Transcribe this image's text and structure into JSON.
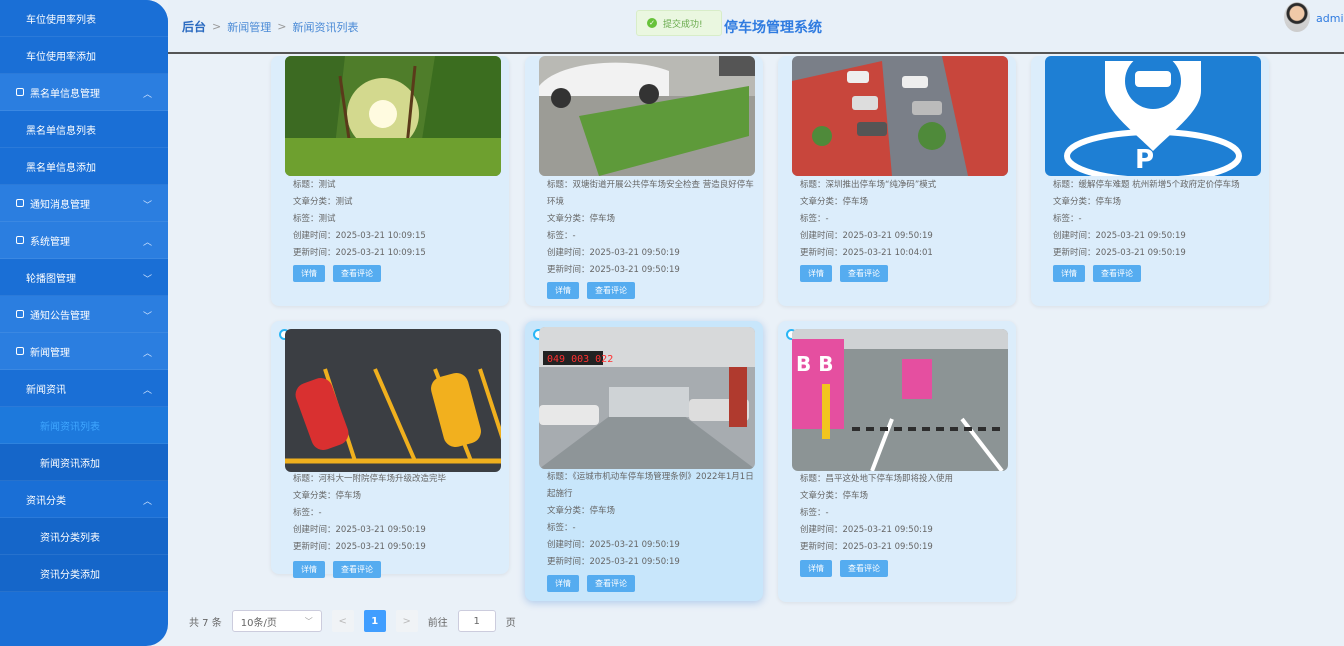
{
  "sidebar": {
    "items": [
      {
        "label": "车位使用率列表"
      },
      {
        "label": "车位使用率添加"
      },
      {
        "label": "黑名单信息管理",
        "chev": "^"
      },
      {
        "label": "黑名单信息列表"
      },
      {
        "label": "黑名单信息添加"
      },
      {
        "label": "通知消息管理",
        "chev": "v"
      },
      {
        "label": "系统管理",
        "chev": "^"
      },
      {
        "label": "轮播图管理",
        "chev": "v"
      },
      {
        "label": "通知公告管理",
        "chev": "v"
      },
      {
        "label": "新闻管理",
        "chev": "^"
      },
      {
        "label": "新闻资讯",
        "chev": "^"
      },
      {
        "label": "新闻资讯列表"
      },
      {
        "label": "新闻资讯添加"
      },
      {
        "label": "资讯分类",
        "chev": "^"
      },
      {
        "label": "资讯分类列表"
      },
      {
        "label": "资讯分类添加"
      }
    ]
  },
  "header": {
    "breadcrumb": [
      "后台",
      "新闻管理",
      "新闻资讯列表"
    ],
    "title": "停车场管理系统",
    "toast": "提交成功!",
    "user": "admin"
  },
  "cards": [
    {
      "title": "标题：测试",
      "category": "文章分类：测试",
      "tags": "标签：测试",
      "created": "创建时间：2025-03-21 10:09:15",
      "updated": "更新时间：2025-03-21 10:09:15",
      "detail": "详情",
      "comments": "查看评论"
    },
    {
      "title": "标题：双塘街道开展公共停车场安全检查 营造良好停车环境",
      "category": "文章分类：停车场",
      "tags": "标签：-",
      "created": "创建时间：2025-03-21 09:50:19",
      "updated": "更新时间：2025-03-21 09:50:19",
      "detail": "详情",
      "comments": "查看评论"
    },
    {
      "title": "标题：深圳推出停车场“纯净码”模式",
      "category": "文章分类：停车场",
      "tags": "标签：-",
      "created": "创建时间：2025-03-21 09:50:19",
      "updated": "更新时间：2025-03-21 10:04:01",
      "detail": "详情",
      "comments": "查看评论"
    },
    {
      "title": "标题：缓解停车难题 杭州新增5个政府定价停车场",
      "category": "文章分类：停车场",
      "tags": "标签：-",
      "created": "创建时间：2025-03-21 09:50:19",
      "updated": "更新时间：2025-03-21 09:50:19",
      "detail": "详情",
      "comments": "查看评论"
    },
    {
      "title": "标题：河科大一附院停车场升级改造完毕",
      "category": "文章分类：停车场",
      "tags": "标签：-",
      "created": "创建时间：2025-03-21 09:50:19",
      "updated": "更新时间：2025-03-21 09:50:19",
      "detail": "详情",
      "comments": "查看评论"
    },
    {
      "title": "标题：《运城市机动车停车场管理条例》2022年1月1日起施行",
      "category": "文章分类：停车场",
      "tags": "标签：-",
      "created": "创建时间：2025-03-21 09:50:19",
      "updated": "更新时间：2025-03-21 09:50:19",
      "detail": "详情",
      "comments": "查看评论"
    },
    {
      "title": "标题：昌平这处地下停车场即将投入使用",
      "category": "文章分类：停车场",
      "tags": "标签：-",
      "created": "创建时间：2025-03-21 09:50:19",
      "updated": "更新时间：2025-03-21 09:50:19",
      "detail": "详情",
      "comments": "查看评论"
    }
  ],
  "pager": {
    "total": "共 7 条",
    "size": "10条/页",
    "prev": "<",
    "page": "1",
    "next": ">",
    "goto": "前往",
    "goto_value": "1",
    "unit": "页"
  },
  "colors": {
    "sidebar": "#1a6fd6",
    "accent": "#409eff",
    "button": "#55acf0"
  }
}
